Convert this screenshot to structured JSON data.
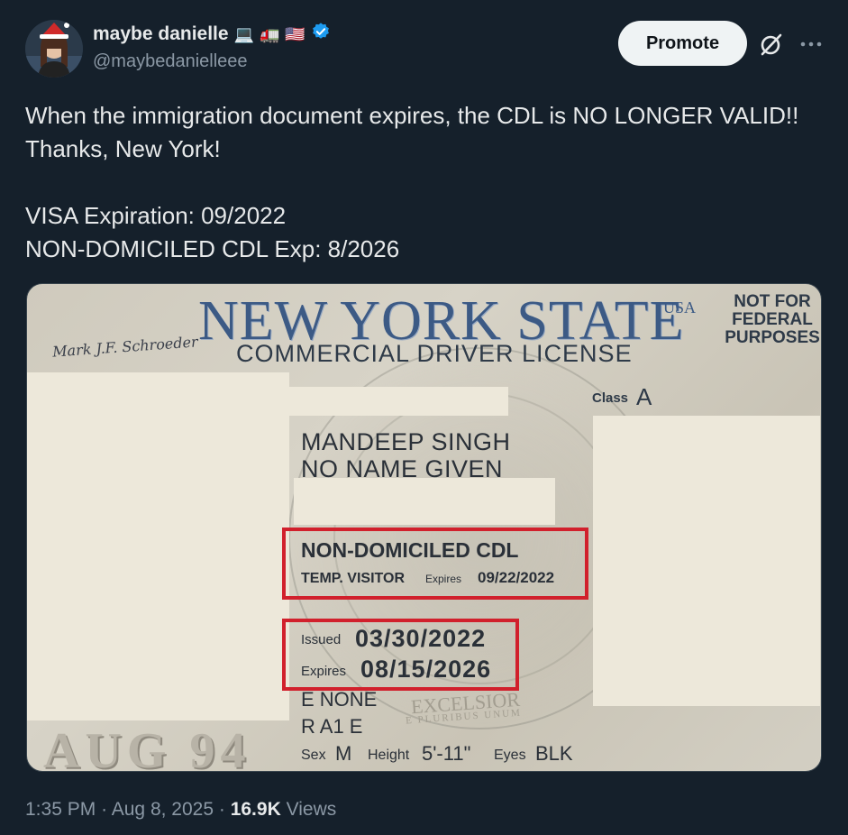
{
  "author": {
    "display_name": "maybe danielle",
    "handle": "@maybedanielleee",
    "name_emojis": [
      "💻",
      "🚛",
      "🇺🇸"
    ],
    "verified_icon": "verified-badge-icon",
    "verified_color": "#1d9bf0"
  },
  "actions": {
    "promote_label": "Promote",
    "grok_icon": "grok-icon",
    "more_icon": "more-icon"
  },
  "tweet": {
    "line1": "When the immigration document expires, the CDL is NO LONGER VALID!!",
    "line2": "Thanks, New York!",
    "line3": "VISA Expiration: 09/2022",
    "line4": "NON-DOMICILED CDL Exp: 8/2026"
  },
  "license_image": {
    "state_title": "NEW YORK STATE",
    "usa": "USA",
    "not_for_federal": "NOT FOR FEDERAL PURPOSES",
    "license_type": "COMMERCIAL DRIVER LICENSE",
    "signature": "Mark J.F. Schroeder",
    "class_label": "Class",
    "class_value": "A",
    "name_line1": "MANDEEP SINGH",
    "name_line2": "NO NAME GIVEN",
    "non_domiciled": "NON-DOMICILED CDL",
    "temp_visitor": "TEMP. VISITOR",
    "temp_expires_label": "Expires",
    "temp_expires_value": "09/22/2022",
    "issued_label": "Issued",
    "issued_value": "03/30/2022",
    "expires_label": "Expires",
    "expires_value": "08/15/2026",
    "endorsement": "E NONE",
    "restriction": "R A1 E",
    "sex_label": "Sex",
    "sex_value": "M",
    "height_label": "Height",
    "height_value": "5'-11\"",
    "eyes_label": "Eyes",
    "eyes_value": "BLK",
    "ghost_dob": "AUG 94",
    "excelsior": "EXCELSIOR",
    "pluribus": "E PLURIBUS UNUM",
    "highlight_color": "#d1202c"
  },
  "footer": {
    "time": "1:35 PM",
    "date": "Aug 8, 2025",
    "separator": "·",
    "views_count": "16.9K",
    "views_label": "Views"
  }
}
